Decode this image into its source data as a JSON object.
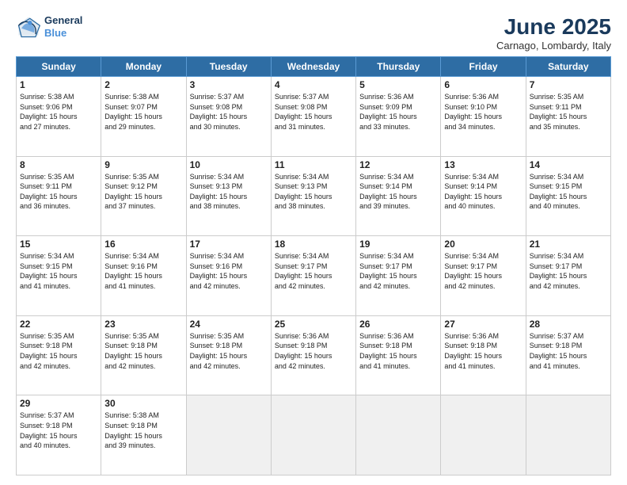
{
  "logo": {
    "line1": "General",
    "line2": "Blue"
  },
  "title": "June 2025",
  "subtitle": "Carnago, Lombardy, Italy",
  "weekdays": [
    "Sunday",
    "Monday",
    "Tuesday",
    "Wednesday",
    "Thursday",
    "Friday",
    "Saturday"
  ],
  "weeks": [
    [
      {
        "day": "1",
        "info": "Sunrise: 5:38 AM\nSunset: 9:06 PM\nDaylight: 15 hours\nand 27 minutes."
      },
      {
        "day": "2",
        "info": "Sunrise: 5:38 AM\nSunset: 9:07 PM\nDaylight: 15 hours\nand 29 minutes."
      },
      {
        "day": "3",
        "info": "Sunrise: 5:37 AM\nSunset: 9:08 PM\nDaylight: 15 hours\nand 30 minutes."
      },
      {
        "day": "4",
        "info": "Sunrise: 5:37 AM\nSunset: 9:08 PM\nDaylight: 15 hours\nand 31 minutes."
      },
      {
        "day": "5",
        "info": "Sunrise: 5:36 AM\nSunset: 9:09 PM\nDaylight: 15 hours\nand 33 minutes."
      },
      {
        "day": "6",
        "info": "Sunrise: 5:36 AM\nSunset: 9:10 PM\nDaylight: 15 hours\nand 34 minutes."
      },
      {
        "day": "7",
        "info": "Sunrise: 5:35 AM\nSunset: 9:11 PM\nDaylight: 15 hours\nand 35 minutes."
      }
    ],
    [
      {
        "day": "8",
        "info": "Sunrise: 5:35 AM\nSunset: 9:11 PM\nDaylight: 15 hours\nand 36 minutes."
      },
      {
        "day": "9",
        "info": "Sunrise: 5:35 AM\nSunset: 9:12 PM\nDaylight: 15 hours\nand 37 minutes."
      },
      {
        "day": "10",
        "info": "Sunrise: 5:34 AM\nSunset: 9:13 PM\nDaylight: 15 hours\nand 38 minutes."
      },
      {
        "day": "11",
        "info": "Sunrise: 5:34 AM\nSunset: 9:13 PM\nDaylight: 15 hours\nand 38 minutes."
      },
      {
        "day": "12",
        "info": "Sunrise: 5:34 AM\nSunset: 9:14 PM\nDaylight: 15 hours\nand 39 minutes."
      },
      {
        "day": "13",
        "info": "Sunrise: 5:34 AM\nSunset: 9:14 PM\nDaylight: 15 hours\nand 40 minutes."
      },
      {
        "day": "14",
        "info": "Sunrise: 5:34 AM\nSunset: 9:15 PM\nDaylight: 15 hours\nand 40 minutes."
      }
    ],
    [
      {
        "day": "15",
        "info": "Sunrise: 5:34 AM\nSunset: 9:15 PM\nDaylight: 15 hours\nand 41 minutes."
      },
      {
        "day": "16",
        "info": "Sunrise: 5:34 AM\nSunset: 9:16 PM\nDaylight: 15 hours\nand 41 minutes."
      },
      {
        "day": "17",
        "info": "Sunrise: 5:34 AM\nSunset: 9:16 PM\nDaylight: 15 hours\nand 42 minutes."
      },
      {
        "day": "18",
        "info": "Sunrise: 5:34 AM\nSunset: 9:17 PM\nDaylight: 15 hours\nand 42 minutes."
      },
      {
        "day": "19",
        "info": "Sunrise: 5:34 AM\nSunset: 9:17 PM\nDaylight: 15 hours\nand 42 minutes."
      },
      {
        "day": "20",
        "info": "Sunrise: 5:34 AM\nSunset: 9:17 PM\nDaylight: 15 hours\nand 42 minutes."
      },
      {
        "day": "21",
        "info": "Sunrise: 5:34 AM\nSunset: 9:17 PM\nDaylight: 15 hours\nand 42 minutes."
      }
    ],
    [
      {
        "day": "22",
        "info": "Sunrise: 5:35 AM\nSunset: 9:18 PM\nDaylight: 15 hours\nand 42 minutes."
      },
      {
        "day": "23",
        "info": "Sunrise: 5:35 AM\nSunset: 9:18 PM\nDaylight: 15 hours\nand 42 minutes."
      },
      {
        "day": "24",
        "info": "Sunrise: 5:35 AM\nSunset: 9:18 PM\nDaylight: 15 hours\nand 42 minutes."
      },
      {
        "day": "25",
        "info": "Sunrise: 5:36 AM\nSunset: 9:18 PM\nDaylight: 15 hours\nand 42 minutes."
      },
      {
        "day": "26",
        "info": "Sunrise: 5:36 AM\nSunset: 9:18 PM\nDaylight: 15 hours\nand 41 minutes."
      },
      {
        "day": "27",
        "info": "Sunrise: 5:36 AM\nSunset: 9:18 PM\nDaylight: 15 hours\nand 41 minutes."
      },
      {
        "day": "28",
        "info": "Sunrise: 5:37 AM\nSunset: 9:18 PM\nDaylight: 15 hours\nand 41 minutes."
      }
    ],
    [
      {
        "day": "29",
        "info": "Sunrise: 5:37 AM\nSunset: 9:18 PM\nDaylight: 15 hours\nand 40 minutes."
      },
      {
        "day": "30",
        "info": "Sunrise: 5:38 AM\nSunset: 9:18 PM\nDaylight: 15 hours\nand 39 minutes."
      },
      {
        "day": "",
        "info": ""
      },
      {
        "day": "",
        "info": ""
      },
      {
        "day": "",
        "info": ""
      },
      {
        "day": "",
        "info": ""
      },
      {
        "day": "",
        "info": ""
      }
    ]
  ]
}
